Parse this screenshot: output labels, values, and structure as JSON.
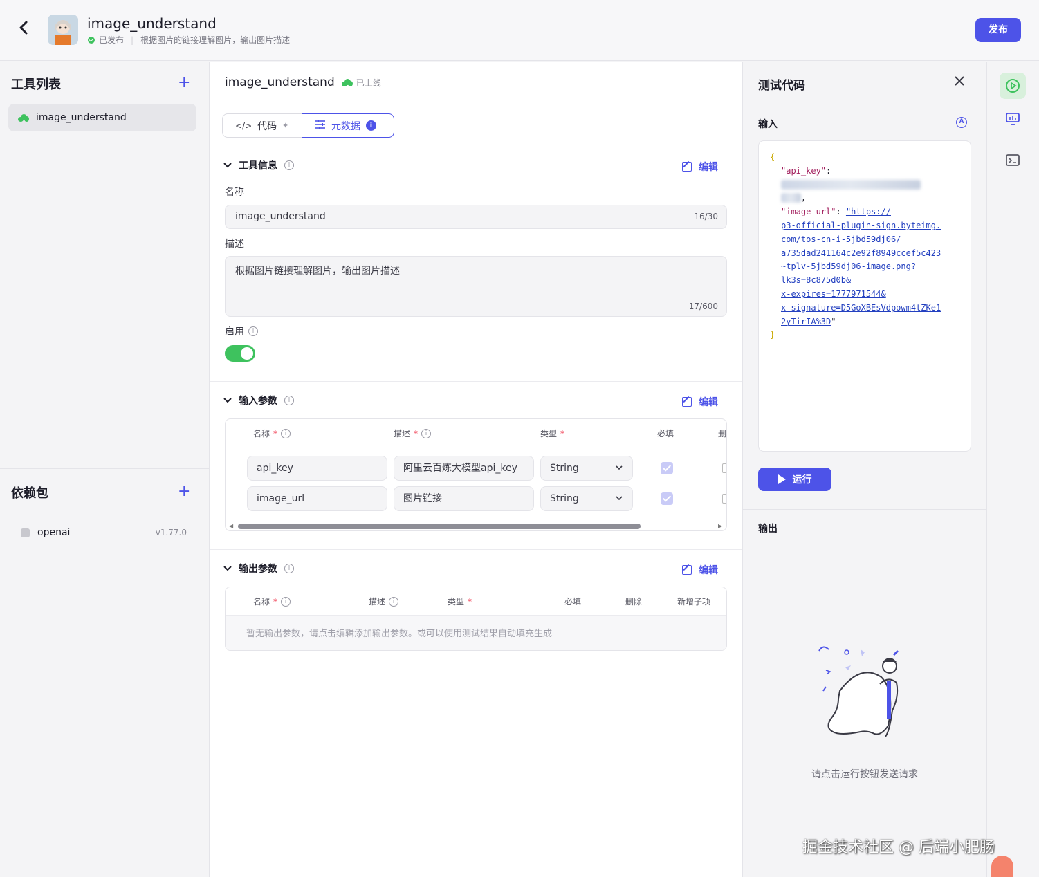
{
  "header": {
    "app_title": "image_understand",
    "status": "已发布",
    "description": "根据图片的链接理解图片，输出图片描述",
    "publish_label": "发布"
  },
  "sidebar": {
    "tools_title": "工具列表",
    "tools": [
      {
        "label": "image_understand"
      }
    ],
    "deps_title": "依赖包",
    "deps": [
      {
        "name": "openai",
        "version": "v1.77.0"
      }
    ]
  },
  "main": {
    "title": "image_understand",
    "status": "已上线",
    "tabs": [
      {
        "label": "代码"
      },
      {
        "label": "元数据"
      }
    ],
    "tool_info": {
      "title": "工具信息",
      "edit_label": "编辑",
      "name_label": "名称",
      "name_value": "image_understand",
      "name_counter": "16/30",
      "desc_label": "描述",
      "desc_value": "根据图片链接理解图片，输出图片描述",
      "desc_counter": "17/600",
      "enabled_label": "启用",
      "enabled": true
    },
    "input_params": {
      "title": "输入参数",
      "edit_label": "编辑",
      "headers": {
        "name": "名称",
        "desc": "描述",
        "type": "类型",
        "required": "必填",
        "delete": "删"
      },
      "rows": [
        {
          "name": "api_key",
          "desc": "阿里云百炼大模型api_key",
          "type": "String",
          "required": true
        },
        {
          "name": "image_url",
          "desc": "图片链接",
          "type": "String",
          "required": true
        }
      ]
    },
    "output_params": {
      "title": "输出参数",
      "edit_label": "编辑",
      "headers": {
        "name": "名称",
        "desc": "描述",
        "type": "类型",
        "required": "必填",
        "delete": "删除",
        "add_child": "新增子项"
      },
      "empty_tip": "暂无输出参数，请点击编辑添加输出参数。或可以使用测试结果自动填充生成"
    }
  },
  "test_panel": {
    "title": "测试代码",
    "input_label": "输入",
    "code": {
      "open_brace": "{",
      "key1": "\"api_key\"",
      "colon": ":",
      "val1_masked": "sk-d553795296d954c87b2e4a1f0",
      "val1_tail": "2c00",
      "comma": ",",
      "key2": "\"image_url\"",
      "url_lines": [
        "\"https://",
        "p3-official-plugin-sign.byteimg.",
        "com/tos-cn-i-5jbd59dj06/",
        "a735dad241164c2e92f8949ccef5c423",
        "~tplv-5jbd59dj06-image.png?",
        "lk3s=8c875d0b&",
        "x-expires=1777971544&",
        "x-signature=D5GoXBEsVdpowm4tZKe1",
        "2yTirIA%3D"
      ],
      "close_quote": "\"",
      "close_brace": "}"
    },
    "run_label": "运行",
    "output_label": "输出",
    "output_tip": "请点击运行按钮发送请求"
  },
  "watermark": "掘金技术社区 @ 后端小肥肠",
  "colors": {
    "accent": "#4d53e8",
    "success": "#3ec25e",
    "required": "#f0384e"
  }
}
